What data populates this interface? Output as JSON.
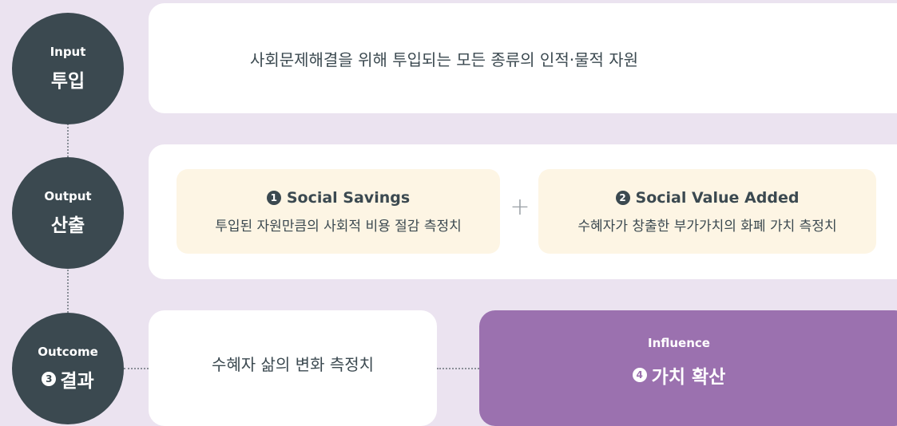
{
  "input": {
    "en": "Input",
    "ko": "투입",
    "description": "사회문제해결을 위해 투입되는 모든 종류의 인적·물적 자원"
  },
  "output": {
    "en": "Output",
    "ko": "산출",
    "plus_symbol": "+",
    "items": [
      {
        "number": "1",
        "title": "Social Savings",
        "desc": "투입된 자원만큼의 사회적 비용 절감 측정치"
      },
      {
        "number": "2",
        "title": "Social Value Added",
        "desc": "수혜자가 창출한 부가가치의 화폐 가치 측정치"
      }
    ]
  },
  "outcome": {
    "en": "Outcome",
    "number": "3",
    "ko": "결과",
    "description": "수혜자 삶의 변화 측정치"
  },
  "influence": {
    "en": "Influence",
    "number": "4",
    "ko": "가치 확산"
  },
  "colors": {
    "background": "#ebe3f0",
    "circle": "#3b4950",
    "card": "#ffffff",
    "sub_card": "#fdf5e4",
    "influence": "#9b71af"
  }
}
